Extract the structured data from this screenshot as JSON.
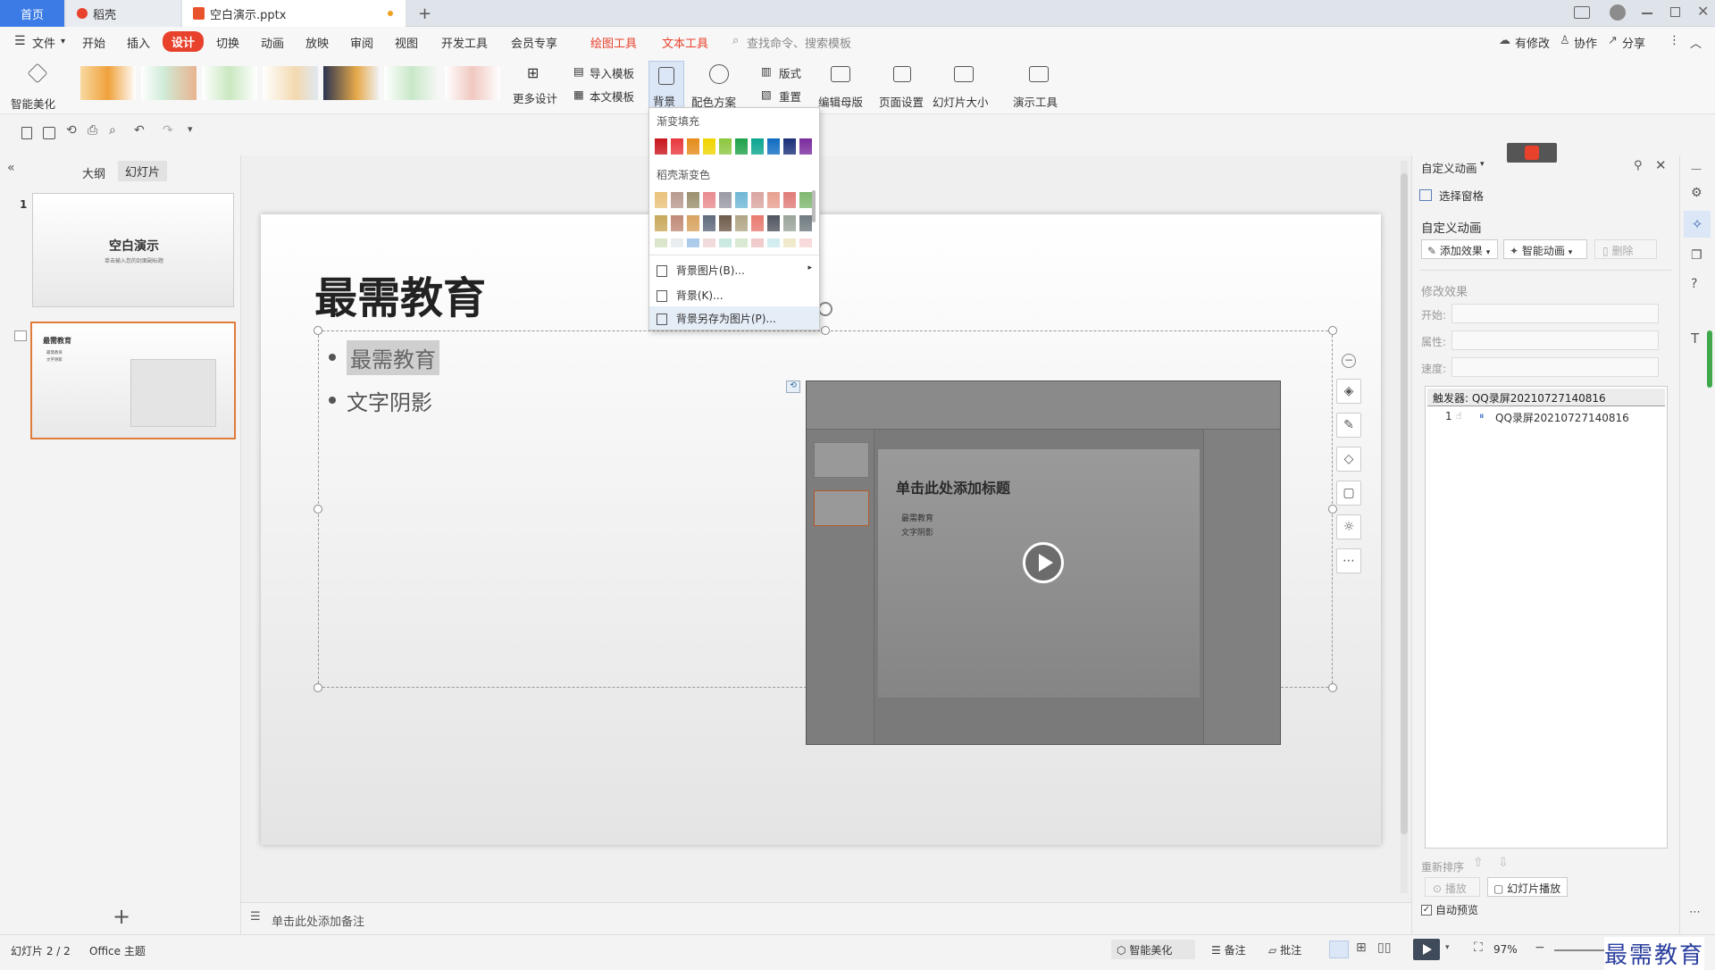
{
  "titlebar": {
    "tabs": [
      {
        "label": "首页"
      },
      {
        "label": "稻壳"
      },
      {
        "label": "空白演示.pptx"
      }
    ],
    "new_tab": "+"
  },
  "menu": {
    "file": "文件",
    "items": [
      "开始",
      "插入",
      "设计",
      "切换",
      "动画",
      "放映",
      "审阅",
      "视图",
      "开发工具",
      "会员专享"
    ],
    "context_tabs": [
      "绘图工具",
      "文本工具"
    ],
    "search_placeholder": "查找命令、搜索模板",
    "right": [
      "有修改",
      "协作",
      "分享"
    ]
  },
  "ribbon": {
    "smart_beautify": "智能美化",
    "more_design": "更多设计",
    "import_template": "导入模板",
    "this_template": "本文模板",
    "background": "背景",
    "color_scheme": "配色方案",
    "layout": "版式",
    "reset": "重置",
    "edit_master": "编辑母版",
    "page_setup": "页面设置",
    "slide_size": "幻灯片大小",
    "present_tools": "演示工具"
  },
  "dropdown": {
    "gradient_fill": "渐变填充",
    "gradient_colors": [
      "#c8161d",
      "#e8383d",
      "#e58b1a",
      "#f0d400",
      "#8cc63f",
      "#1ea04a",
      "#0aa58f",
      "#0f6cc2",
      "#1b2f7a",
      "#7b2c9e"
    ],
    "daoke_gradient": "稻壳渐变色",
    "daoke_row1": [
      "#e9c27a",
      "#b89a8f",
      "#9b8f6e",
      "#e98b8f",
      "#9a9aa5",
      "#6fb7d6",
      "#d9a5a0",
      "#e8a090",
      "#e07c78",
      "#7fb86f"
    ],
    "daoke_row2": [
      "#c9a85a",
      "#c08a77",
      "#d8a25e",
      "#5f6a7c",
      "#6e5a4a",
      "#b0a585",
      "#e87a70",
      "#4f5560",
      "#9aa59a",
      "#6f7a80"
    ],
    "daoke_row3": [
      "#d8e4c8",
      "#e8ecee",
      "#a7c8e8",
      "#f0d8d8",
      "#c8e8e0",
      "#d8e8d0",
      "#f0c8c8",
      "#d0ecf0",
      "#f0e8c8",
      "#f8d8d8"
    ],
    "bg_picture": "背景图片(B)...",
    "bg": "背景(K)...",
    "bg_save": "背景另存为图片(P)..."
  },
  "leftpane": {
    "tabs": [
      "大纲",
      "幻灯片"
    ],
    "slide1": {
      "num": "1",
      "title": "空白演示",
      "subtitle": "单击输入您的封面副标题"
    },
    "slide2": {
      "title": "最需教育",
      "bullets": [
        "最需教育",
        "文字阴影"
      ]
    },
    "add": "+"
  },
  "slide": {
    "title": "最需教育",
    "bullets": [
      "最需教育",
      "文字阴影"
    ],
    "video": {
      "inner_title": "单击此处添加标题",
      "inner_bullets": [
        "最需教育",
        "文字阴影"
      ]
    }
  },
  "notes": "单击此处添加备注",
  "rightpane": {
    "header": "自定义动画",
    "select_pane": "选择窗格",
    "section": "自定义动画",
    "add_effect": "添加效果",
    "smart_anim": "智能动画",
    "delete": "删除",
    "modify": "修改效果",
    "start": "开始:",
    "property": "属性:",
    "speed": "速度:",
    "trigger": "触发器: QQ录屏20210727140816",
    "item_num": "1",
    "item_name": "QQ录屏20210727140816",
    "reorder": "重新排序",
    "play": "播放",
    "slideshow": "幻灯片播放",
    "autopreview": "自动预览"
  },
  "statusbar": {
    "slide_info": "幻灯片 2 / 2",
    "theme": "Office 主题",
    "smart": "智能美化",
    "notes": "备注",
    "comment": "批注",
    "zoom": "97%",
    "watermark": "最需教育"
  }
}
